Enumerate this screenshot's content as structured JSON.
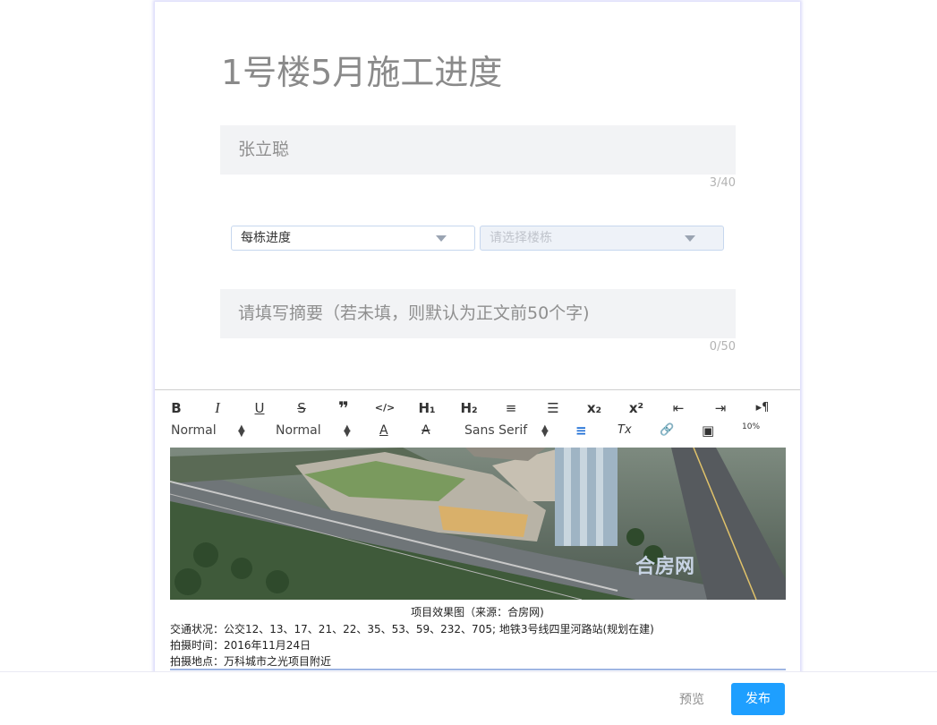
{
  "title": "1号楼5月施工进度",
  "author_field": {
    "value": "张立聪",
    "counter": "3/40"
  },
  "selects": {
    "category": {
      "value": "每栋进度"
    },
    "building": {
      "placeholder": "请选择楼栋"
    }
  },
  "summary_field": {
    "placeholder": "请填写摘要（若未填，则默认为正文前50个字)",
    "counter": "0/50"
  },
  "toolbar": {
    "row1": [
      {
        "name": "bold-icon",
        "glyph": "B"
      },
      {
        "name": "italic-icon",
        "glyph": "I"
      },
      {
        "name": "underline-icon",
        "glyph": "U"
      },
      {
        "name": "strike-icon",
        "glyph": "S"
      },
      {
        "name": "blockquote-icon",
        "glyph": "❞"
      },
      {
        "name": "code-block-icon",
        "glyph": "</>"
      },
      {
        "name": "header-1-icon",
        "glyph": "H₁"
      },
      {
        "name": "header-2-icon",
        "glyph": "H₂"
      },
      {
        "name": "ordered-list-icon",
        "glyph": "≡"
      },
      {
        "name": "bullet-list-icon",
        "glyph": "☰"
      },
      {
        "name": "subscript-icon",
        "glyph": "x₂"
      },
      {
        "name": "superscript-icon",
        "glyph": "x²"
      },
      {
        "name": "outdent-icon",
        "glyph": "⇤"
      },
      {
        "name": "indent-icon",
        "glyph": "⇥"
      },
      {
        "name": "rtl-direction-icon",
        "glyph": "▸¶"
      }
    ],
    "size_picker": "Normal",
    "header_picker": "Normal",
    "font_picker": "Sans Serif",
    "text_color_glyph": "A",
    "background_color_glyph": "A",
    "align_glyph": "≡",
    "clean_glyph": "Tx",
    "link_glyph": "🔗",
    "image_glyph": "▣",
    "video_glyph": "10%"
  },
  "content": {
    "image_watermark": "合房网",
    "caption": "项目效果图（来源：合房网)",
    "lines": [
      "交通状况：公交12、13、17、21、22、35、53、59、232、705; 地铁3号线四里河路站(规划在建)",
      "拍摄时间：2016年11月24日",
      "拍摄地点：万科城市之光项目附近"
    ]
  },
  "actions": {
    "preview": "预览",
    "publish": "发布"
  },
  "colors": {
    "accent": "#1e9fff",
    "field_bg": "#f2f3f5",
    "align_active": "#1f6fd6"
  }
}
